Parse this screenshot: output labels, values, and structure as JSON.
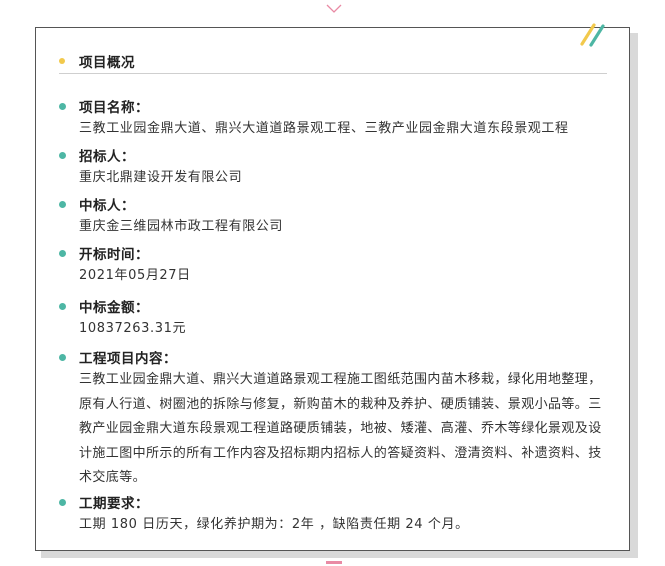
{
  "section": {
    "title": "项目概况"
  },
  "items": [
    {
      "label": "项目名称：",
      "value": "三教工业园金鼎大道、鼎兴大道道路景观工程、三教产业园金鼎大道东段景观工程"
    },
    {
      "label": "招标人：",
      "value": "重庆北鼎建设开发有限公司"
    },
    {
      "label": "中标人：",
      "value": "重庆金三维园林市政工程有限公司"
    },
    {
      "label": "开标时间：",
      "value": "2021年05月27日"
    },
    {
      "label": "中标金额：",
      "value": "10837263.31元"
    },
    {
      "label": "工程项目内容：",
      "value": "三教工业园金鼎大道、鼎兴大道道路景观工程施工图纸范围内苗木移栽，绿化用地整理，原有人行道、树圈池的拆除与修复，新购苗木的栽种及养护、硬质铺装、景观小品等。三教产业园金鼎大道东段景观工程道路硬质铺装，地被、矮灌、高灌、乔木等绿化景观及设计施工图中所示的所有工作内容及招标期内招标人的答疑资料、澄清资料、补遗资料、技术交底等。"
    },
    {
      "label": "工期要求：",
      "value": "工期 180 日历天，绿化养护期为：2年 ，缺陷责任期  24 个月。"
    }
  ],
  "colors": {
    "header_dot": "#f2c94c",
    "bullet": "#4db6a4",
    "deco_yellow": "#f2c94c",
    "deco_teal": "#4db6a4",
    "chevron": "#e98aa4"
  }
}
